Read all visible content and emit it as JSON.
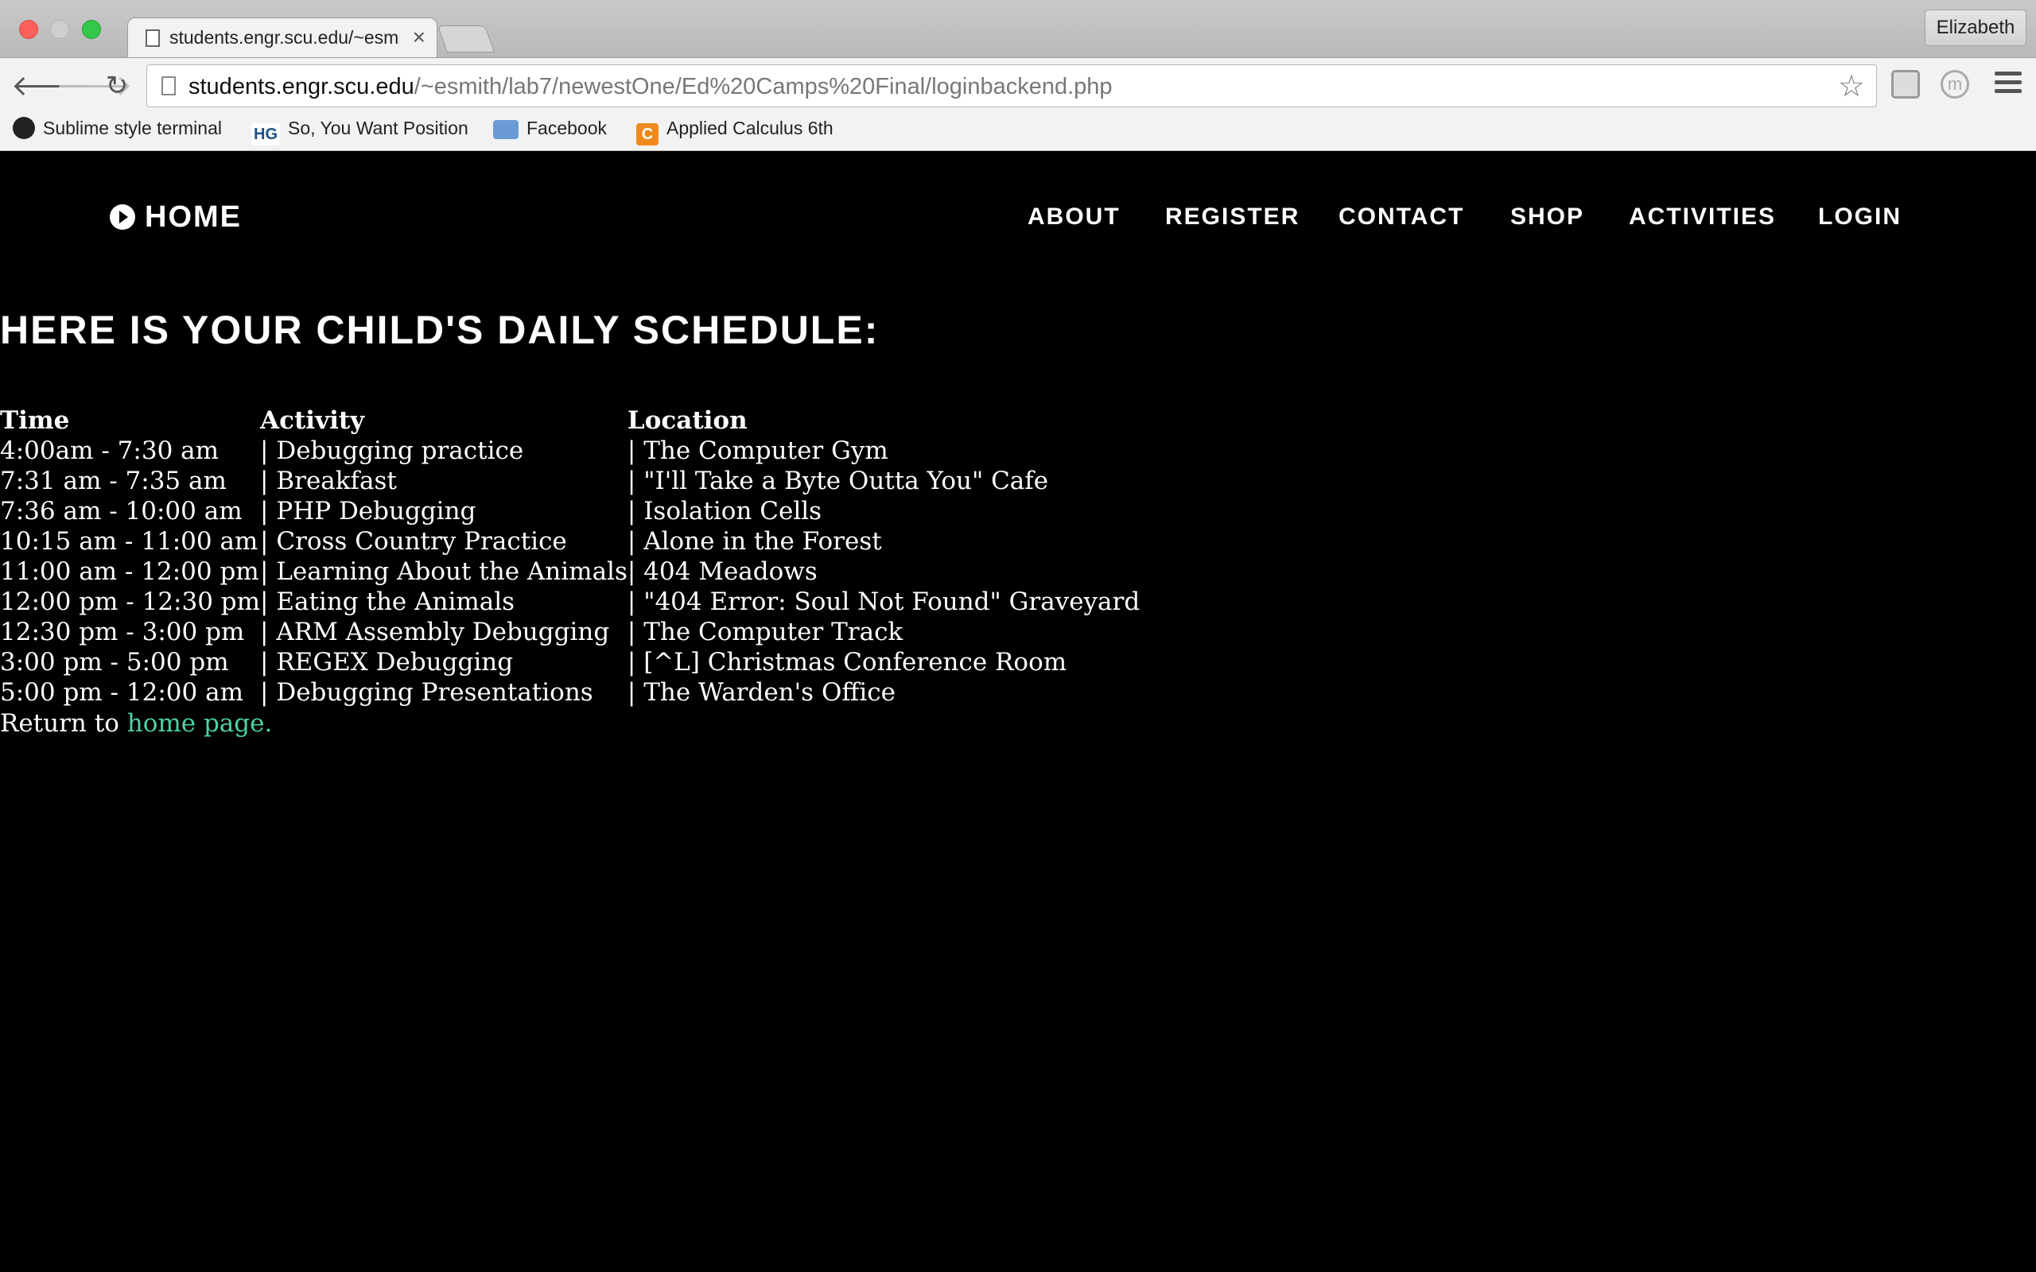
{
  "browser": {
    "tab_title": "students.engr.scu.edu/~esmith",
    "tab_close": "×",
    "profile_name": "Elizabeth",
    "url_host": "students.engr.scu.edu",
    "url_path": "/~esmith/lab7/newestOne/Ed%20Camps%20Final/loginbackend.php",
    "back_icon": "🡐",
    "forward_icon": "🡒",
    "reload_icon": "↻",
    "star_icon": "☆",
    "bookmarks": [
      {
        "icon": "github-icon",
        "label": "Sublime style terminal"
      },
      {
        "icon": "hg-icon",
        "icon_text": "HG",
        "label": "So, You Want Position"
      },
      {
        "icon": "folder-icon",
        "label": "Facebook"
      },
      {
        "icon": "c-icon",
        "icon_text": "C",
        "label": "Applied Calculus 6th"
      }
    ]
  },
  "site_nav": {
    "home": "HOME",
    "items": [
      "ABOUT",
      "REGISTER",
      "CONTACT",
      "SHOP",
      "ACTIVITIES",
      "LOGIN"
    ]
  },
  "heading": "HERE IS YOUR CHILD'S DAILY SCHEDULE:",
  "schedule": {
    "headers": [
      "Time",
      "Activity",
      "Location"
    ],
    "rows": [
      [
        "4:00am - 7:30 am",
        "| Debugging practice",
        "| The Computer Gym"
      ],
      [
        "7:31 am - 7:35 am",
        "| Breakfast",
        "| \"I'll Take a Byte Outta You\" Cafe"
      ],
      [
        "7:36 am - 10:00 am",
        "| PHP Debugging",
        "| Isolation Cells"
      ],
      [
        "10:15 am - 11:00 am",
        "| Cross Country Practice",
        "| Alone in the Forest"
      ],
      [
        "11:00 am - 12:00 pm",
        "| Learning About the Animals",
        "| 404 Meadows"
      ],
      [
        "12:00 pm - 12:30 pm",
        "| Eating the Animals",
        "| \"404 Error: Soul Not Found\" Graveyard"
      ],
      [
        "12:30 pm - 3:00 pm",
        "| ARM Assembly Debugging",
        "| The Computer Track"
      ],
      [
        "3:00 pm - 5:00 pm",
        "| REGEX Debugging",
        "| [^L] Christmas Conference Room"
      ],
      [
        "5:00 pm - 12:00 am",
        "| Debugging Presentations",
        "| The Warden's Office"
      ]
    ]
  },
  "footer": {
    "prefix": "Return to ",
    "link_text": "home page."
  },
  "colors": {
    "page_background": "#000000",
    "text": "#ffffff",
    "link": "#4fd1a5"
  }
}
